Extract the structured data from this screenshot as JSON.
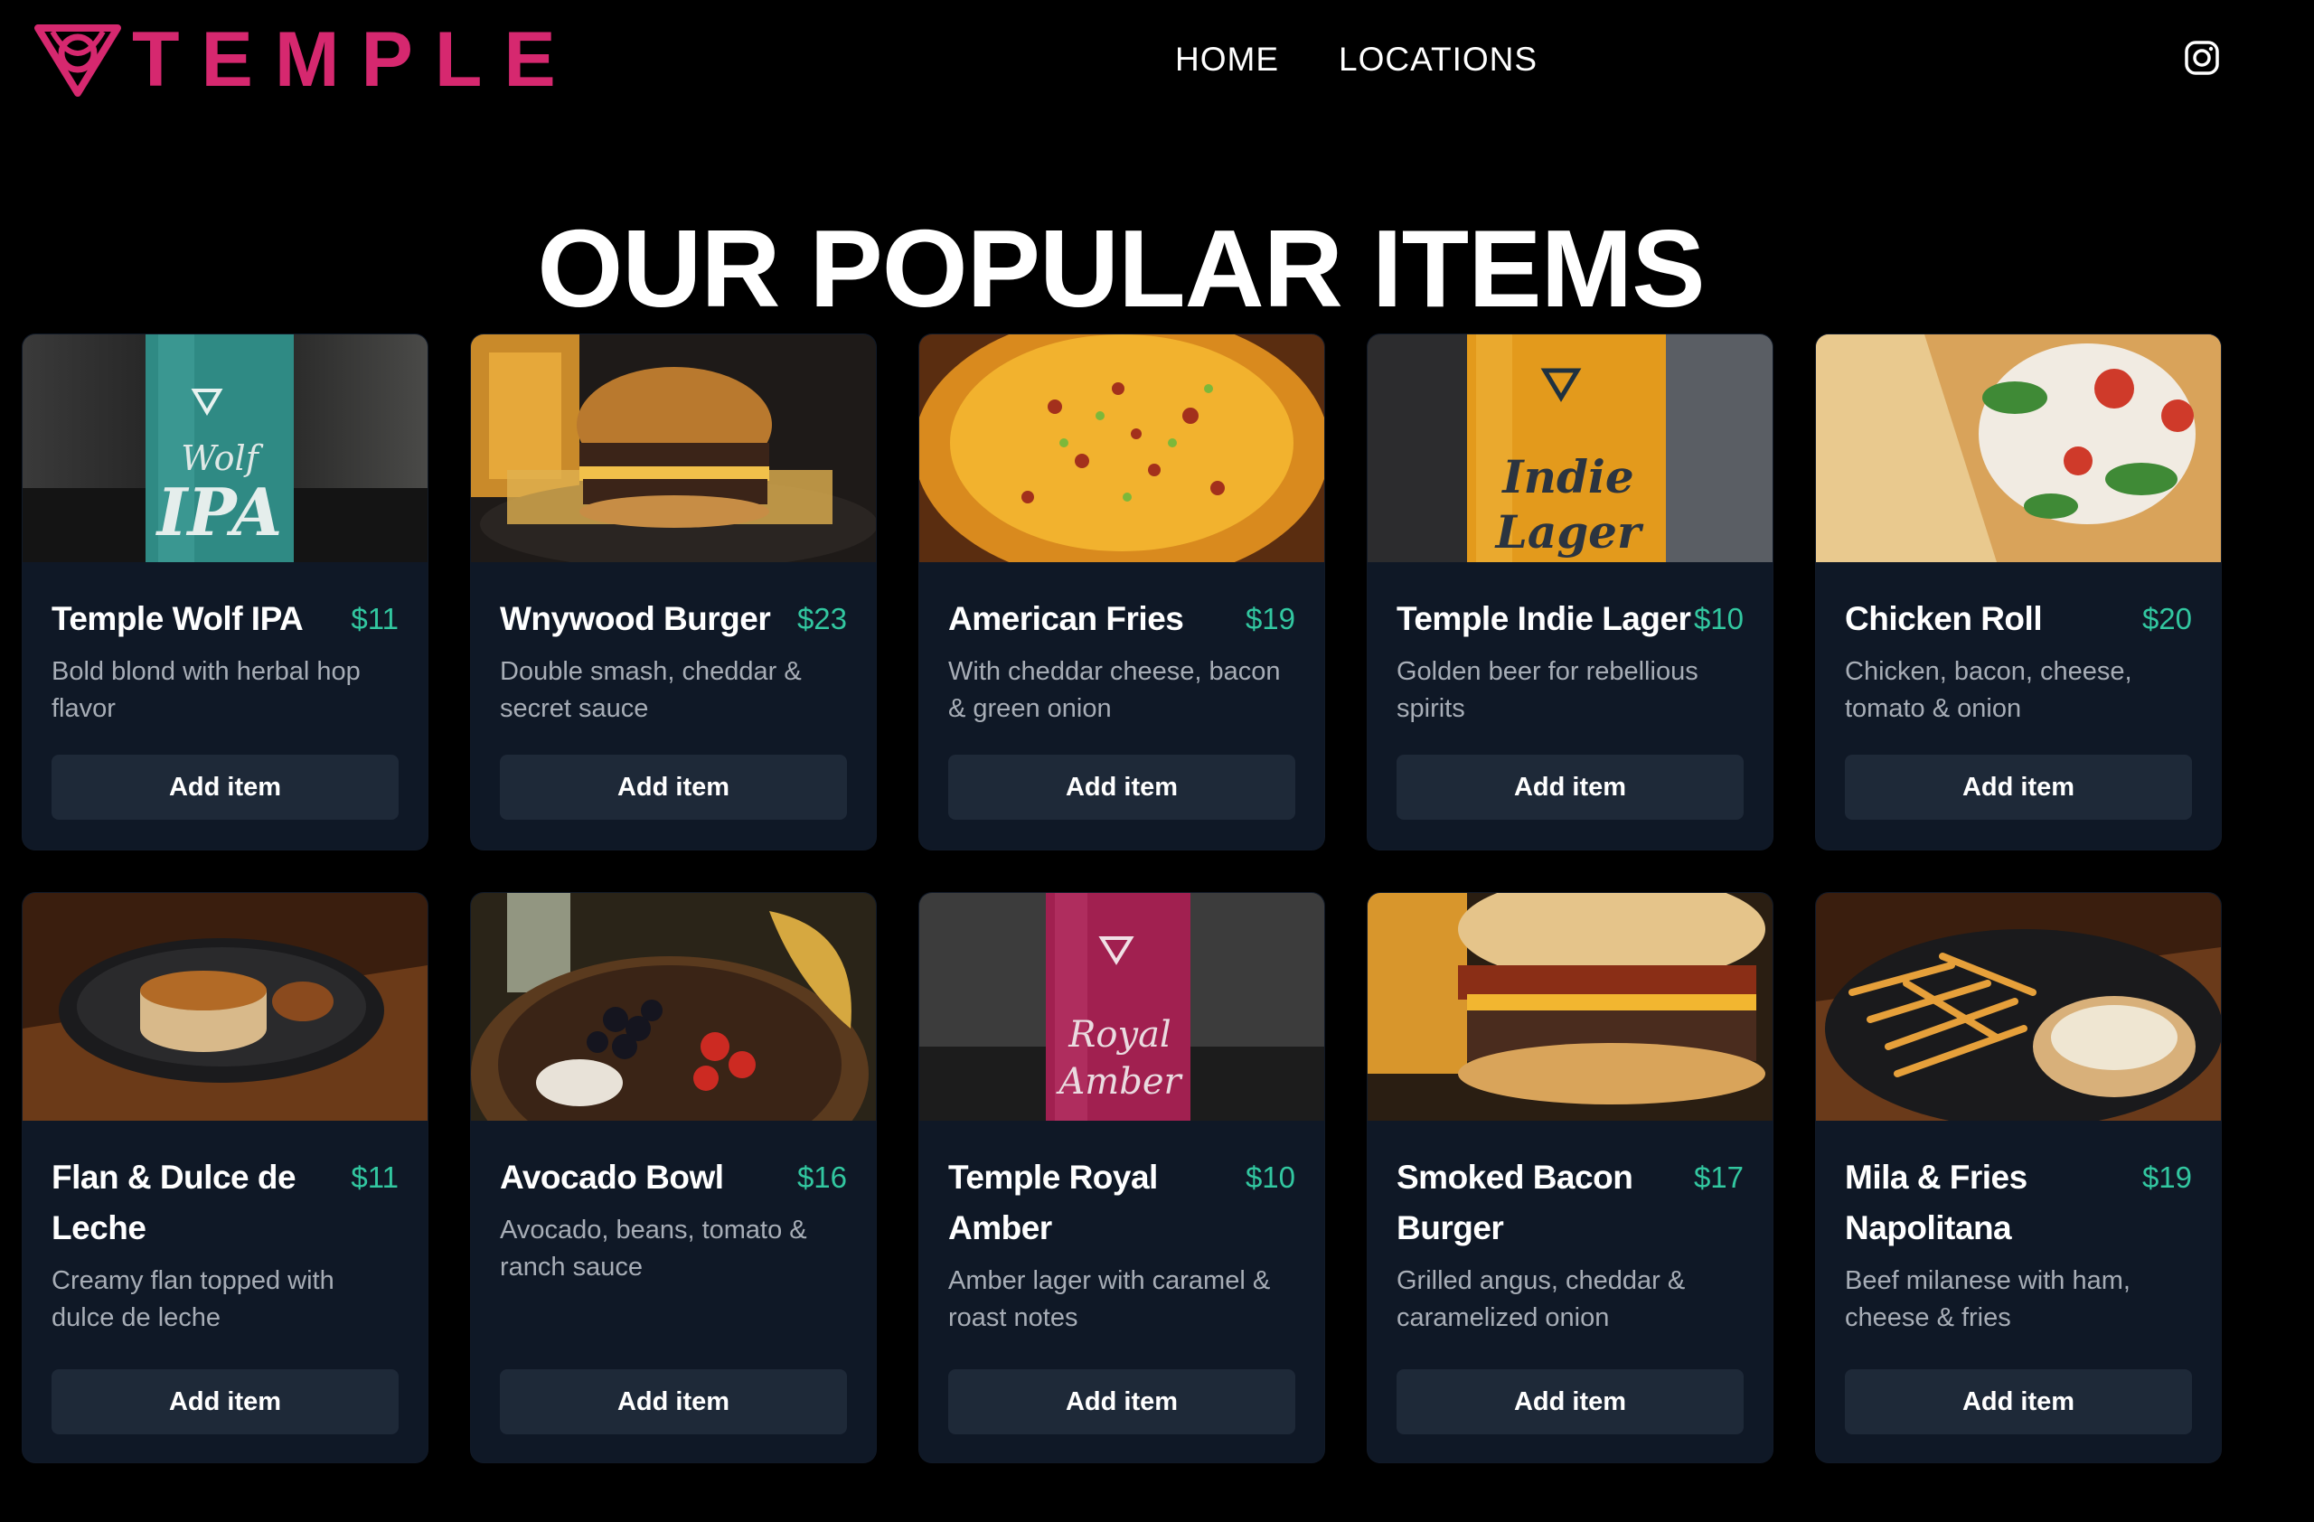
{
  "brand": {
    "name": "TEMPLE",
    "color": "#d6286f"
  },
  "nav": {
    "items": [
      "HOME",
      "LOCATIONS"
    ]
  },
  "social": {
    "icon": "instagram-icon"
  },
  "page": {
    "title": "OUR POPULAR ITEMS"
  },
  "colors": {
    "background": "#000000",
    "card": "#0f1826",
    "button": "#1e2938",
    "price": "#32c7a0",
    "description": "#a7adb6"
  },
  "items": [
    {
      "name": "Temple Wolf IPA",
      "price": "$11",
      "desc": "Bold blond with herbal hop flavor",
      "button": "Add item",
      "image": "beer-can-photo-teal",
      "can_label": "Wolf IPA"
    },
    {
      "name": "Wnywood Burger",
      "price": "$23",
      "desc": "Double smash, cheddar & secret sauce",
      "button": "Add item",
      "image": "burger-photo"
    },
    {
      "name": "American Fries",
      "price": "$19",
      "desc": "With cheddar cheese, bacon & green onion",
      "button": "Add item",
      "image": "loaded-fries-photo"
    },
    {
      "name": "Temple Indie Lager",
      "price": "$10",
      "desc": "Golden beer for rebellious spirits",
      "button": "Add item",
      "image": "beer-can-photo-orange",
      "can_label": "Indie Lager"
    },
    {
      "name": "Chicken Roll",
      "price": "$20",
      "desc": "Chicken, bacon, cheese, tomato & onion",
      "button": "Add item",
      "image": "wrap-photo"
    },
    {
      "name": "Flan & Dulce de Leche",
      "price": "$11",
      "desc": "Creamy flan topped with dulce de leche",
      "button": "Add item",
      "image": "flan-photo"
    },
    {
      "name": "Avocado Bowl",
      "price": "$16",
      "desc": "Avocado, beans, tomato & ranch sauce",
      "button": "Add item",
      "image": "bowl-photo"
    },
    {
      "name": "Temple Royal Amber",
      "price": "$10",
      "desc": "Amber lager with caramel & roast notes",
      "button": "Add item",
      "image": "beer-can-photo-pink",
      "can_label": "Royal Amber"
    },
    {
      "name": "Smoked Bacon Burger",
      "price": "$17",
      "desc": "Grilled angus, cheddar & caramelized onion",
      "button": "Add item",
      "image": "bacon-burger-photo"
    },
    {
      "name": "Mila & Fries Napolitana",
      "price": "$19",
      "desc": "Beef milanese with ham, cheese & fries",
      "button": "Add item",
      "image": "milanesa-photo"
    }
  ]
}
